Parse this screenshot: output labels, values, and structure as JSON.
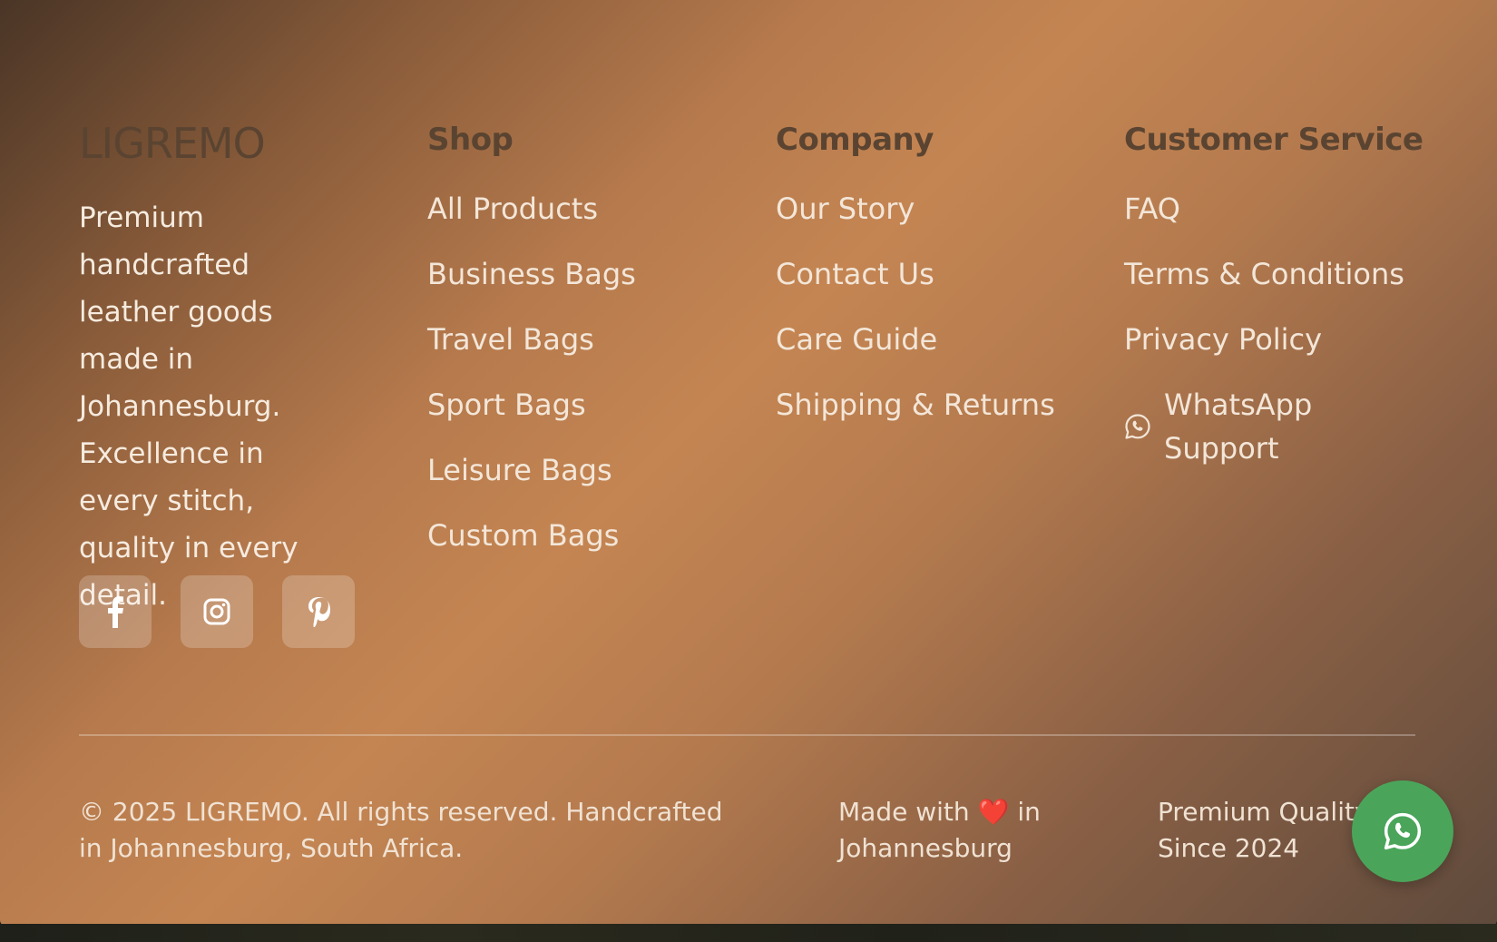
{
  "brand": {
    "logo": "LIGREMO",
    "tagline": "Premium handcrafted leather goods made in Johannesburg. Excellence in every stitch, quality in every detail."
  },
  "socials": [
    {
      "icon": "facebook-icon"
    },
    {
      "icon": "instagram-icon"
    },
    {
      "icon": "pinterest-icon"
    }
  ],
  "shop": {
    "heading": "Shop",
    "links": [
      "All Products",
      "Business Bags",
      "Travel Bags",
      "Sport Bags",
      "Leisure Bags",
      "Custom Bags"
    ]
  },
  "company": {
    "heading": "Company",
    "links": [
      "Our Story",
      "Contact Us",
      "Care Guide",
      "Shipping & Returns"
    ]
  },
  "service": {
    "heading": "Customer Service",
    "links": [
      "FAQ",
      "Terms & Conditions",
      "Privacy Policy"
    ],
    "whatsapp": "WhatsApp Support"
  },
  "bottom": {
    "copyright": "© 2025 LIGREMO. All rights reserved. Handcrafted in Johannesburg, South Africa.",
    "made_prefix": "Made with",
    "heart": "❤️",
    "made_suffix": "in Johannesburg",
    "since": "Premium Quality Since 2024"
  },
  "colors": {
    "whatsapp": "#4aa55a",
    "heading": "#5a4431",
    "gradient_mid": "#c48552"
  }
}
